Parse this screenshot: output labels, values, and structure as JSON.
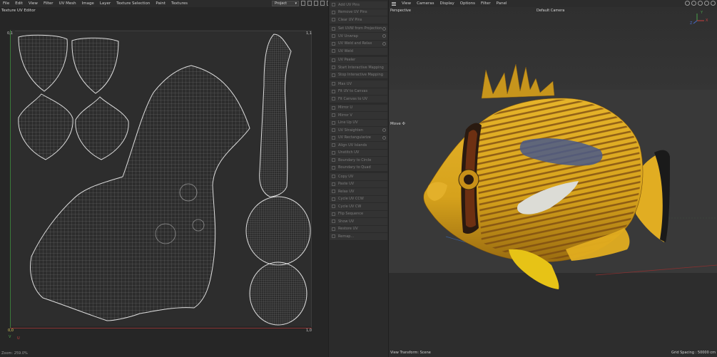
{
  "uv_menu": {
    "items": [
      "File",
      "Edit",
      "View",
      "Filter",
      "UV Mesh",
      "Image",
      "Layer",
      "Texture Selection",
      "Paint",
      "Textures"
    ]
  },
  "project_select": {
    "value": "Project"
  },
  "uv_editor": {
    "title": "Texture UV Editor",
    "corner_top_left": "0,1",
    "corner_top_right": "1,1",
    "corner_bottom_left": "0,0",
    "corner_bottom_right": "1,0",
    "axis_u": "U",
    "axis_v": "V",
    "zoom": "Zoom: 259.0%",
    "wire_color": "#d9d9d9"
  },
  "commands": {
    "group1": [
      "Add UV Pins",
      "Remove UV Pins",
      "Clear UV Pins"
    ],
    "group2": [
      "Set UVW from Projection",
      "UV Unwrap",
      "UV Weld and Relax",
      "UV Weld"
    ],
    "group3": [
      "UV Peeler",
      "Start Interactive Mapping",
      "Stop Interactive Mapping"
    ],
    "group4": [
      "Max UV",
      "Fit UV to Canvas",
      "Fit Canvas to UV"
    ],
    "group5": [
      "Mirror U",
      "Mirror V",
      "Line Up UV",
      "UV Straighten",
      "UV Rectangularize",
      "Align UV Islands",
      "Unstitch UV",
      "Boundary to Circle",
      "Boundary to Quad"
    ],
    "group6": [
      "Copy UV",
      "Paste UV",
      "Relax UV",
      "Cycle UV CCW",
      "Cycle UV CW",
      "Flip Sequence",
      "Show UV",
      "Restore UV",
      "Remap..."
    ]
  },
  "viewport_menu": {
    "items": [
      "View",
      "Cameras",
      "Display",
      "Options",
      "Filter",
      "Panel"
    ]
  },
  "viewport": {
    "view_name": "Perspective",
    "camera": "Default Camera",
    "tool": "Move",
    "view_transform": "View Transform: Scene",
    "grid_spacing": "Grid Spacing : 50000 cm",
    "axis_y": "Y",
    "axis_x": "X",
    "axis_z": "Z",
    "fish_body_color": "#d6a21c",
    "fish_stripe_color": "#7a4a12",
    "fish_blue_color": "#4a5a8a"
  }
}
